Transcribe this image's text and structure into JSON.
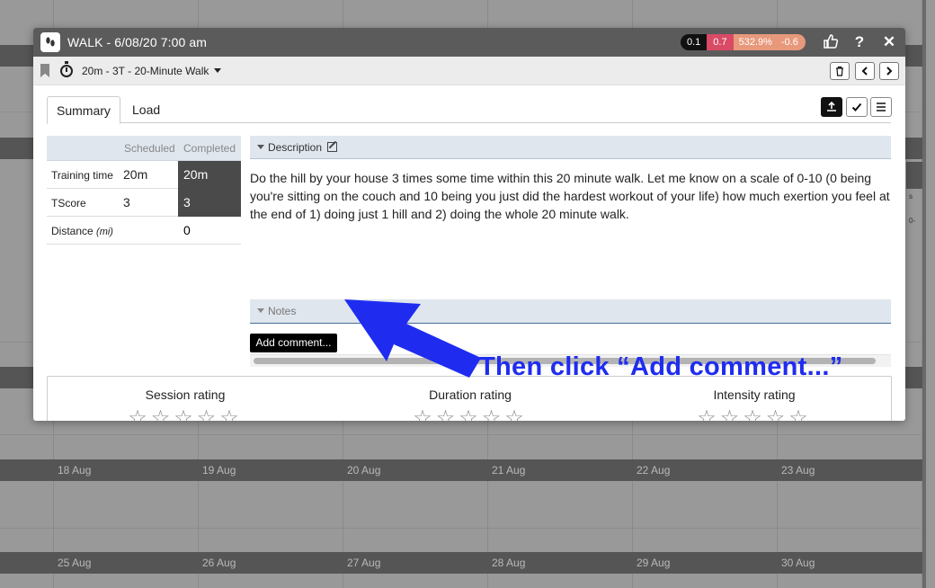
{
  "calendar": {
    "week1": [
      "18 Aug",
      "19 Aug",
      "20 Aug",
      "21 Aug",
      "22 Aug",
      "23 Aug"
    ],
    "week2": [
      "25 Aug",
      "26 Aug",
      "27 Aug",
      "28 Aug",
      "29 Aug",
      "30 Aug"
    ],
    "side_snippets": [
      "s",
      "0-"
    ]
  },
  "modal": {
    "title": "WALK - 6/08/20 7:00 am",
    "metrics": [
      "0.1",
      "0.7",
      "532.9%",
      "-0.6"
    ],
    "icons": {
      "sport": "walk-icon",
      "like": "thumbs-up-icon",
      "help": "question-icon",
      "close": "close-icon"
    },
    "help_label": "?",
    "close_label": "✕",
    "workout_name": "20m - 3T - 20-Minute Walk",
    "tabs": [
      "Summary",
      "Load"
    ],
    "summary": {
      "col_scheduled": "Scheduled",
      "col_completed": "Completed",
      "rows": [
        {
          "label": "Training time",
          "unit": "",
          "scheduled": "20m",
          "completed": "20m"
        },
        {
          "label": "TScore",
          "unit": "",
          "scheduled": "3",
          "completed": "3"
        },
        {
          "label": "Distance",
          "unit": "(mi)",
          "scheduled": "",
          "completed": "0"
        }
      ]
    },
    "description": {
      "header": "Description",
      "text": "Do the hill by your house 3 times some time within this 20 minute walk. Let me know on a scale of 0-10 (0 being you're sitting on the couch and 10 being you just did the hardest workout of your life) how much exertion you feel at the end of 1) doing just 1 hill and 2) doing the whole 20 minute walk."
    },
    "notes": {
      "header": "Notes",
      "add_comment": "Add comment..."
    },
    "ratings": [
      {
        "label": "Session rating",
        "stars": "☆☆☆☆☆"
      },
      {
        "label": "Duration rating",
        "stars": "☆☆☆☆☆"
      },
      {
        "label": "Intensity rating",
        "stars": "☆☆☆☆☆"
      }
    ]
  },
  "annotation": {
    "text": "Then click “Add comment...”",
    "color": "#1f2cf0"
  }
}
